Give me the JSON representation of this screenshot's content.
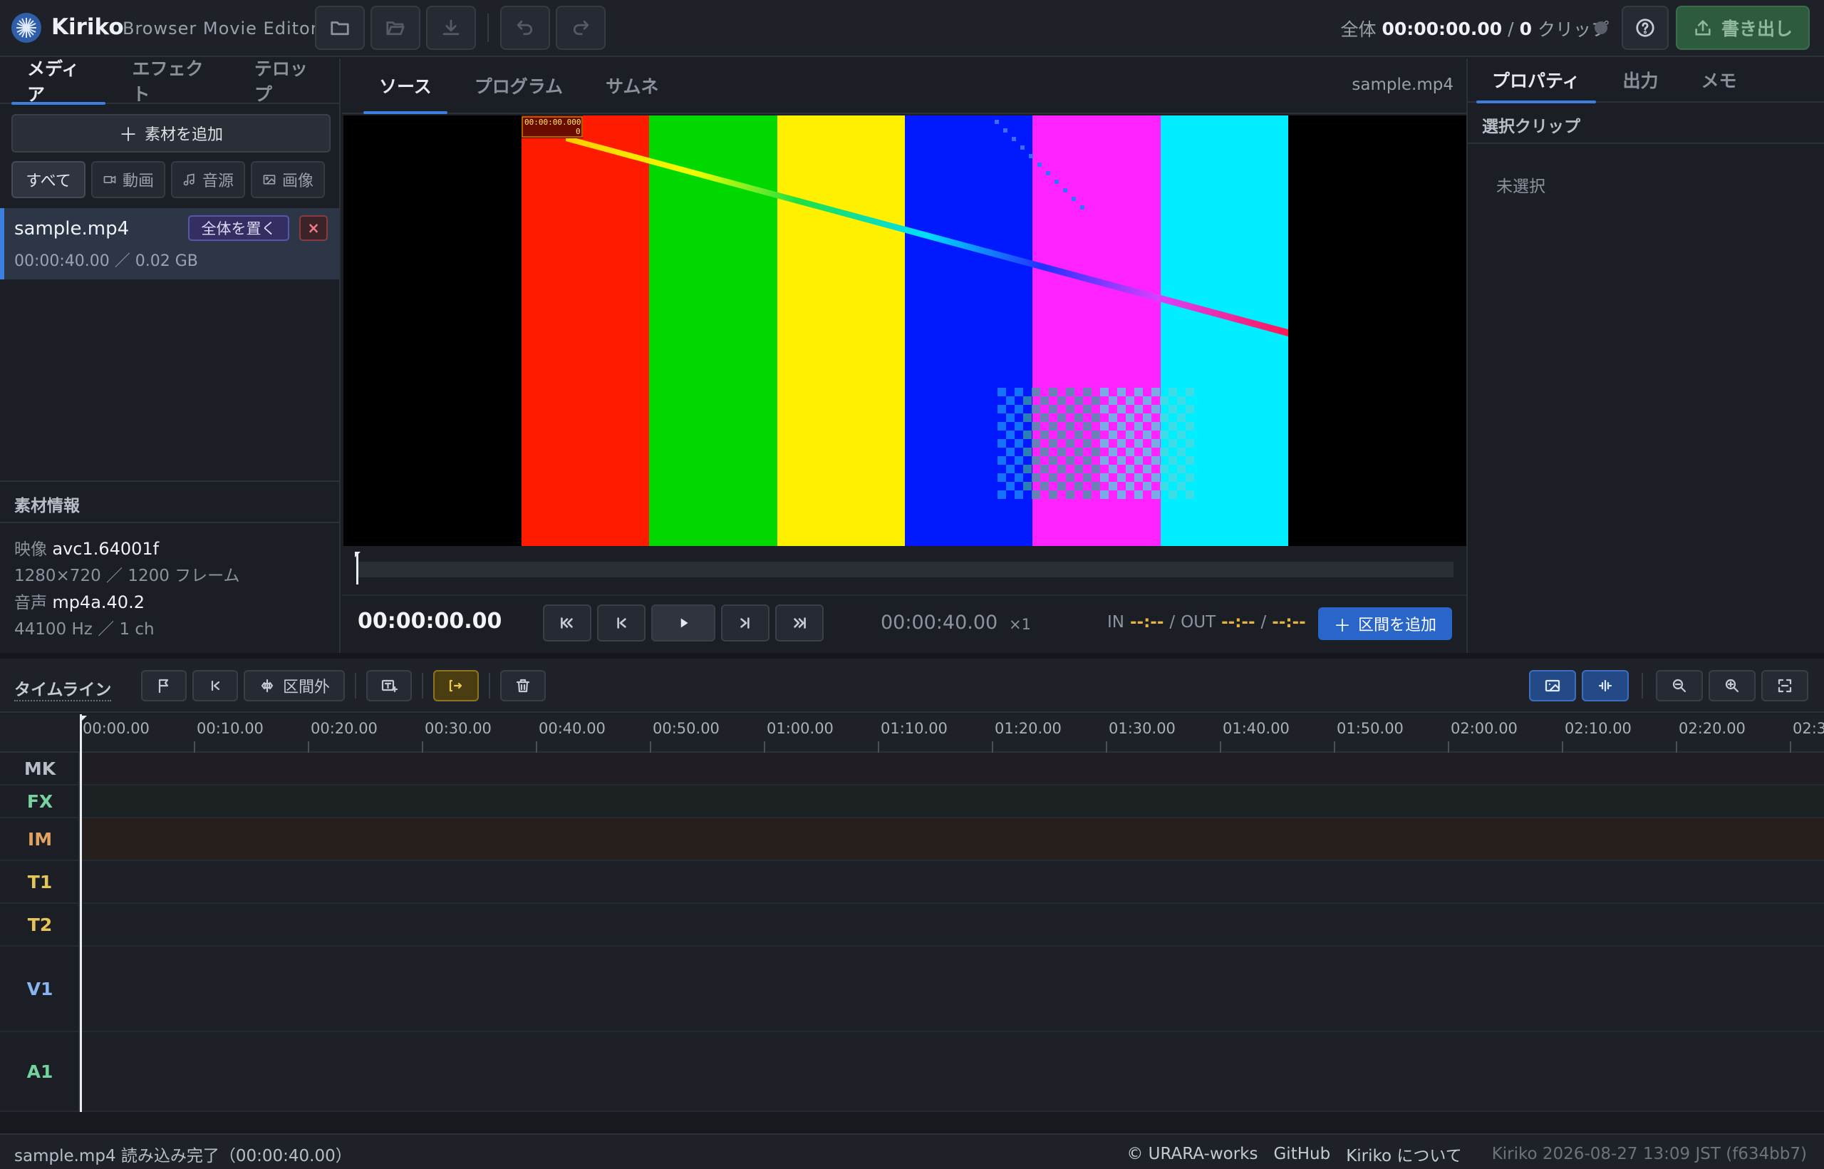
{
  "app": {
    "name": "Kiriko",
    "subtitle": "Browser Movie Editor"
  },
  "header": {
    "total_label": "全体",
    "total_time": "00:00:00.00",
    "separator": "/",
    "clip_count": "0",
    "clip_label": "クリップ",
    "export_label": "書き出し"
  },
  "left": {
    "tabs": [
      "メディア",
      "エフェクト",
      "テロップ"
    ],
    "add_media": "素材を追加",
    "filters": [
      "すべて",
      "動画",
      "音源",
      "画像"
    ],
    "media_item": {
      "name": "sample.mp4",
      "meta": "00:00:40.00 ／ 0.02 GB",
      "place_all": "全体を置く",
      "remove": "×"
    },
    "info_title": "素材情報",
    "info": {
      "video_label": "映像",
      "video_codec": "avc1.64001f",
      "video_detail": "1280×720 ／ 1200 フレーム",
      "audio_label": "音声",
      "audio_codec": "mp4a.40.2",
      "audio_detail": "44100 Hz ／ 1 ch"
    }
  },
  "center": {
    "tabs": [
      "ソース",
      "プログラム",
      "サムネ"
    ],
    "file_name": "sample.mp4",
    "overlay_timecode": "00:00:00.000",
    "overlay_frame": "0",
    "current_time": "00:00:00.00",
    "duration": "00:00:40.00",
    "speed": "×1",
    "in_label": "IN",
    "in_value": "--:--",
    "out_label": "OUT",
    "out_value1": "--:--",
    "out_value2": "--:--",
    "add_range": "区間を追加",
    "colors": [
      "#ff1b00",
      "#00d800",
      "#fff000",
      "#0019ff",
      "#ff23ff",
      "#00eeff"
    ]
  },
  "right": {
    "tabs": [
      "プロパティ",
      "出力",
      "メモ"
    ],
    "section_title": "選択クリップ",
    "empty": "未選択"
  },
  "timeline": {
    "title": "タイムライン",
    "out_of_range": "区間外",
    "ticks": [
      "00:00.00",
      "00:10.00",
      "00:20.00",
      "00:30.00",
      "00:40.00",
      "00:50.00",
      "01:00.00",
      "01:10.00",
      "01:20.00",
      "01:30.00",
      "01:40.00",
      "01:50.00",
      "02:00.00",
      "02:10.00",
      "02:20.00",
      "02:3"
    ],
    "tracks": [
      {
        "id": "MK",
        "color": "#b7bcc6"
      },
      {
        "id": "FX",
        "color": "#76d3a0"
      },
      {
        "id": "IM",
        "color": "#e3a25f"
      },
      {
        "id": "T1",
        "color": "#e5c55a"
      },
      {
        "id": "T2",
        "color": "#e5c55a"
      },
      {
        "id": "V1",
        "color": "#8ab4f0"
      },
      {
        "id": "A1",
        "color": "#74d39a"
      }
    ]
  },
  "status": {
    "message": "sample.mp4 読み込み完了（00:00:40.00）",
    "copyright": "© URARA-works",
    "github": "GitHub",
    "about": "Kiriko について",
    "version": "Kiriko 2026-08-27 13:09 JST (f634bb7)"
  }
}
